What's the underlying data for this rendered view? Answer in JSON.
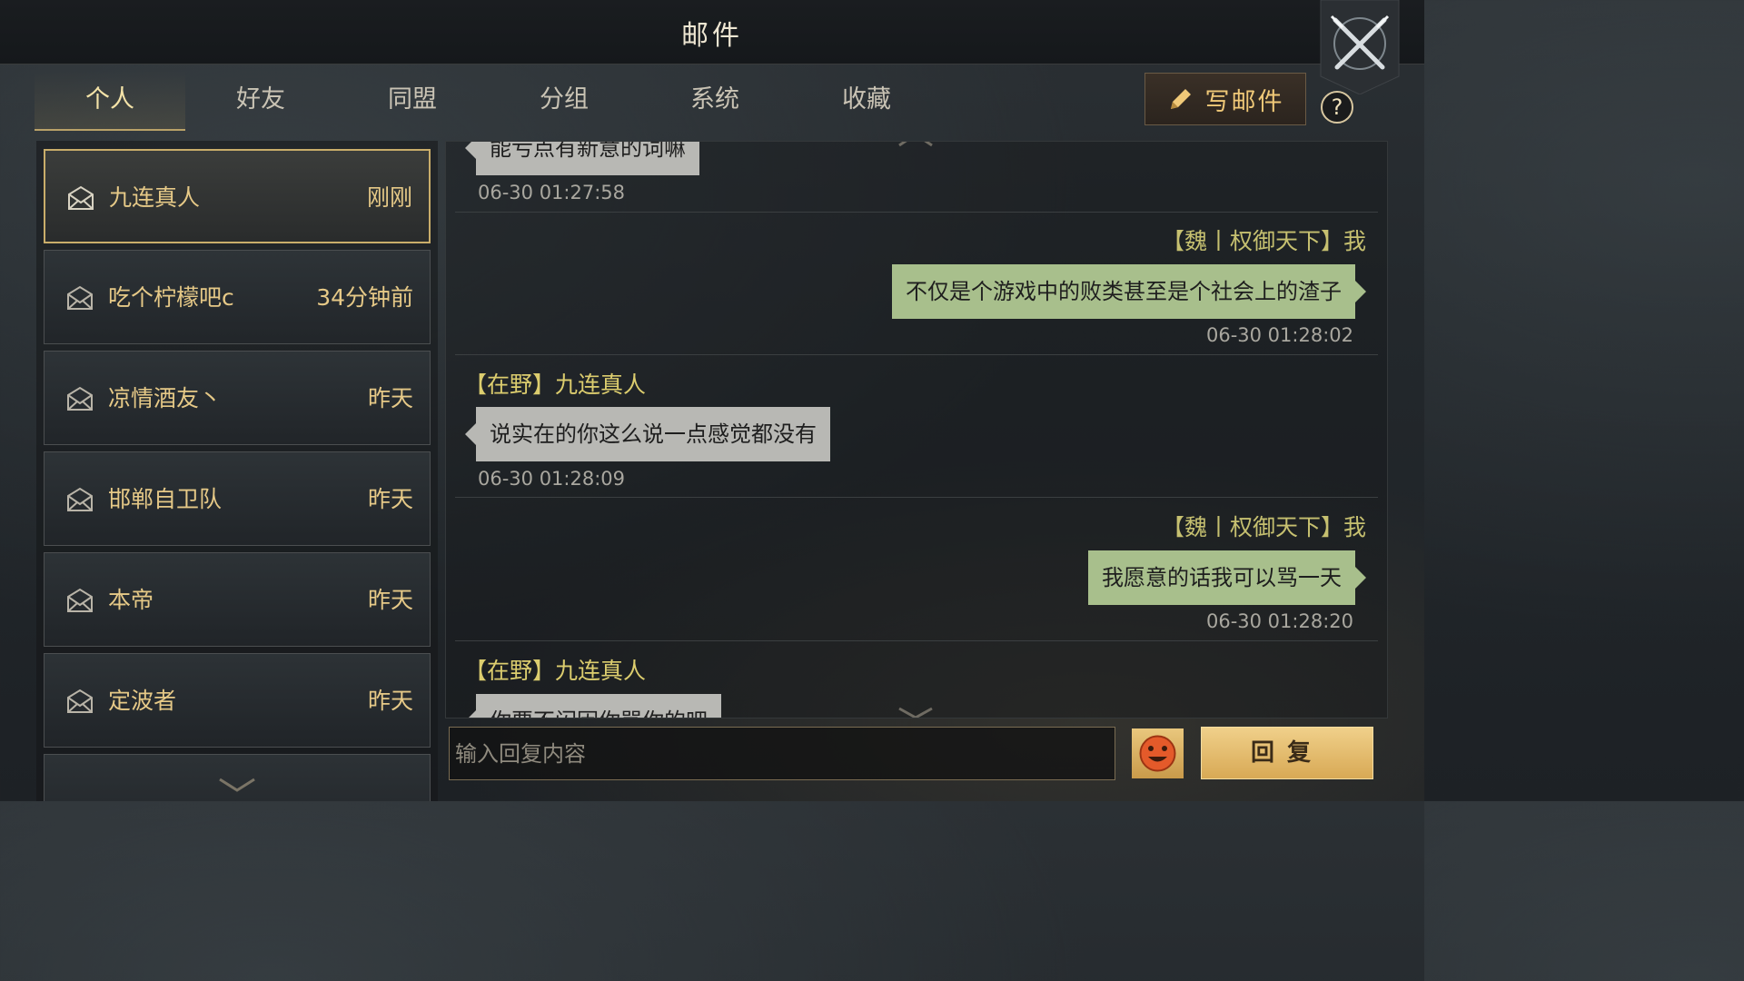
{
  "window": {
    "title": "邮件"
  },
  "tabs": [
    {
      "label": "个人",
      "active": true
    },
    {
      "label": "好友",
      "active": false
    },
    {
      "label": "同盟",
      "active": false
    },
    {
      "label": "分组",
      "active": false
    },
    {
      "label": "系统",
      "active": false
    },
    {
      "label": "收藏",
      "active": false
    }
  ],
  "toolbar": {
    "write_label": "写邮件",
    "write_icon": "pencil-icon",
    "help_label": "?",
    "close_icon": "crossed-swords-close-icon"
  },
  "mail_list": [
    {
      "sender": "九连真人",
      "time": "刚刚",
      "selected": true,
      "icon": "envelope-icon"
    },
    {
      "sender": "吃个柠檬吧c",
      "time": "34分钟前",
      "selected": false,
      "icon": "envelope-icon"
    },
    {
      "sender": "凉情酒友丶",
      "time": "昨天",
      "selected": false,
      "icon": "envelope-icon"
    },
    {
      "sender": "邯郸自卫队",
      "time": "昨天",
      "selected": false,
      "icon": "envelope-icon"
    },
    {
      "sender": "本帝",
      "time": "昨天",
      "selected": false,
      "icon": "envelope-icon"
    },
    {
      "sender": "定波者",
      "time": "昨天",
      "selected": false,
      "icon": "envelope-icon"
    }
  ],
  "messages": [
    {
      "direction": "in",
      "name": "",
      "text": "能亏点有新意的词嘛",
      "time": "06-30 01:27:58"
    },
    {
      "direction": "out",
      "name": "【魏丨权御天下】我",
      "text": "不仅是个游戏中的败类甚至是个社会上的渣子",
      "time": "06-30 01:28:02"
    },
    {
      "direction": "in",
      "name": "【在野】九连真人",
      "text": "说实在的你这么说一点感觉都没有",
      "time": "06-30 01:28:09"
    },
    {
      "direction": "out",
      "name": "【魏丨权御天下】我",
      "text": "我愿意的话我可以骂一天",
      "time": "06-30 01:28:20"
    },
    {
      "direction": "in",
      "name": "【在野】九连真人",
      "text": "你要不闪因你骂你的吧",
      "time": ""
    }
  ],
  "reply": {
    "placeholder": "输入回复内容",
    "value": "",
    "emoji_icon": "smiley-face-icon",
    "button_label": "回复"
  },
  "colors": {
    "accent_gold": "#e6c987",
    "outgoing_bubble": "#a8bf8c",
    "incoming_bubble": "#b8b8b4",
    "sender_tag": "#dccd6e"
  }
}
